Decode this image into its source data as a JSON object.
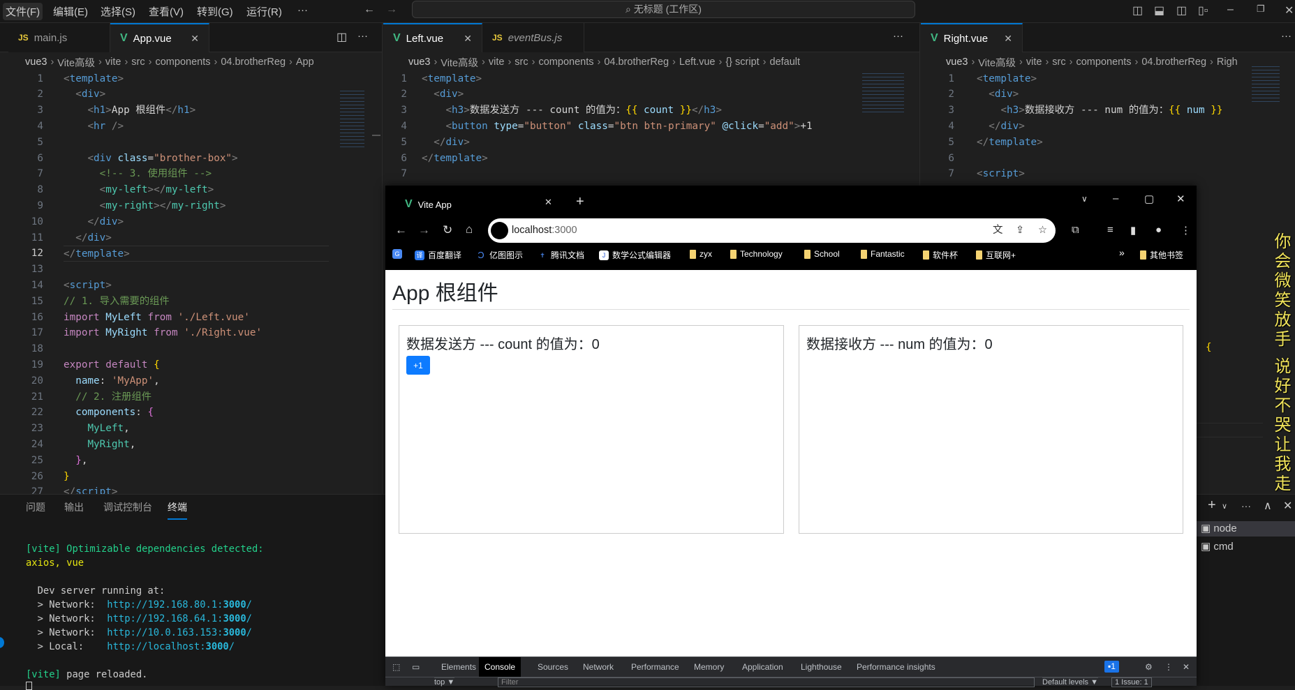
{
  "titlebar": {
    "menu": [
      "文件(F)",
      "编辑(E)",
      "选择(S)",
      "查看(V)",
      "转到(G)",
      "运行(R)",
      "···"
    ],
    "search": "无标题 (工作区)",
    "search_icon": "search-icon"
  },
  "editors": {
    "left": {
      "tabs": [
        {
          "label": "main.js",
          "icon": "JS"
        },
        {
          "label": "App.vue",
          "icon": "V",
          "close": "✕"
        }
      ],
      "breadcrumb": [
        "vue3",
        "Vite高级",
        "vite",
        "src",
        "components",
        "04.brotherReg",
        "App"
      ],
      "current_line": 12,
      "lines": [
        [
          [
            "p",
            "<"
          ],
          [
            "t",
            "template"
          ],
          [
            "p",
            ">"
          ]
        ],
        [
          [
            "w",
            "  "
          ],
          [
            "p",
            "<"
          ],
          [
            "t",
            "div"
          ],
          [
            "p",
            ">"
          ]
        ],
        [
          [
            "w",
            "    "
          ],
          [
            "p",
            "<"
          ],
          [
            "t",
            "h1"
          ],
          [
            "p",
            ">"
          ],
          [
            "w",
            "App 根组件"
          ],
          [
            "p",
            "</"
          ],
          [
            "t",
            "h1"
          ],
          [
            "p",
            ">"
          ]
        ],
        [
          [
            "w",
            "    "
          ],
          [
            "p",
            "<"
          ],
          [
            "t",
            "hr"
          ],
          [
            "p",
            " />"
          ]
        ],
        [],
        [
          [
            "w",
            "    "
          ],
          [
            "p",
            "<"
          ],
          [
            "t",
            "div"
          ],
          [
            "w",
            " "
          ],
          [
            "a",
            "class"
          ],
          [
            "w",
            "="
          ],
          [
            "s",
            "\"brother-box\""
          ],
          [
            "p",
            ">"
          ]
        ],
        [
          [
            "w",
            "      "
          ],
          [
            "c",
            "<!-- 3. 使用组件 -->"
          ]
        ],
        [
          [
            "w",
            "      "
          ],
          [
            "p",
            "<"
          ],
          [
            "g",
            "my-left"
          ],
          [
            "p",
            "></"
          ],
          [
            "g",
            "my-left"
          ],
          [
            "p",
            ">"
          ]
        ],
        [
          [
            "w",
            "      "
          ],
          [
            "p",
            "<"
          ],
          [
            "g",
            "my-right"
          ],
          [
            "p",
            "></"
          ],
          [
            "g",
            "my-right"
          ],
          [
            "p",
            ">"
          ]
        ],
        [
          [
            "w",
            "    "
          ],
          [
            "p",
            "</"
          ],
          [
            "t",
            "div"
          ],
          [
            "p",
            ">"
          ]
        ],
        [
          [
            "w",
            "  "
          ],
          [
            "p",
            "</"
          ],
          [
            "t",
            "div"
          ],
          [
            "p",
            ">"
          ]
        ],
        [
          [
            "p",
            "</"
          ],
          [
            "t",
            "template"
          ],
          [
            "p",
            ">"
          ]
        ],
        [],
        [
          [
            "p",
            "<"
          ],
          [
            "t",
            "script"
          ],
          [
            "p",
            ">"
          ]
        ],
        [
          [
            "c",
            "// 1. 导入需要的组件"
          ]
        ],
        [
          [
            "k",
            "import"
          ],
          [
            "w",
            " "
          ],
          [
            "v",
            "MyLeft"
          ],
          [
            "w",
            " "
          ],
          [
            "k",
            "from"
          ],
          [
            "w",
            " "
          ],
          [
            "s",
            "'./Left.vue'"
          ]
        ],
        [
          [
            "k",
            "import"
          ],
          [
            "w",
            " "
          ],
          [
            "v",
            "MyRight"
          ],
          [
            "w",
            " "
          ],
          [
            "k",
            "from"
          ],
          [
            "w",
            " "
          ],
          [
            "s",
            "'./Right.vue'"
          ]
        ],
        [],
        [
          [
            "k",
            "export"
          ],
          [
            "w",
            " "
          ],
          [
            "k",
            "default"
          ],
          [
            "w",
            " "
          ],
          [
            "y",
            "{"
          ]
        ],
        [
          [
            "w",
            "  "
          ],
          [
            "v",
            "name"
          ],
          [
            "w",
            ": "
          ],
          [
            "s",
            "'MyApp'"
          ],
          [
            "w",
            ","
          ]
        ],
        [
          [
            "w",
            "  "
          ],
          [
            "c",
            "// 2. 注册组件"
          ]
        ],
        [
          [
            "w",
            "  "
          ],
          [
            "v",
            "components"
          ],
          [
            "w",
            ": "
          ],
          [
            "m",
            "{"
          ]
        ],
        [
          [
            "w",
            "    "
          ],
          [
            "g",
            "MyLeft"
          ],
          [
            "w",
            ","
          ]
        ],
        [
          [
            "w",
            "    "
          ],
          [
            "g",
            "MyRight"
          ],
          [
            "w",
            ","
          ]
        ],
        [
          [
            "w",
            "  "
          ],
          [
            "m",
            "}"
          ],
          [
            "w",
            ","
          ]
        ],
        [
          [
            "y",
            "}"
          ]
        ],
        [
          [
            "p",
            "</"
          ],
          [
            "t",
            "script"
          ],
          [
            "p",
            ">"
          ]
        ]
      ]
    },
    "middle": {
      "tabs": [
        {
          "label": "Left.vue",
          "icon": "V",
          "close": "✕"
        },
        {
          "label": "eventBus.js",
          "icon": "JS"
        }
      ],
      "breadcrumb": [
        "vue3",
        "Vite高级",
        "vite",
        "src",
        "components",
        "04.brotherReg",
        "Left.vue",
        "{} script",
        "default"
      ],
      "lines": [
        [
          [
            "p",
            "<"
          ],
          [
            "t",
            "template"
          ],
          [
            "p",
            ">"
          ]
        ],
        [
          [
            "w",
            "  "
          ],
          [
            "p",
            "<"
          ],
          [
            "t",
            "div"
          ],
          [
            "p",
            ">"
          ]
        ],
        [
          [
            "w",
            "    "
          ],
          [
            "p",
            "<"
          ],
          [
            "t",
            "h3"
          ],
          [
            "p",
            ">"
          ],
          [
            "w",
            "数据发送方 --- count 的值为："
          ],
          [
            "y",
            "{{"
          ],
          [
            "v",
            " count "
          ],
          [
            "y",
            "}}"
          ],
          [
            "p",
            "</"
          ],
          [
            "t",
            "h3"
          ],
          [
            "p",
            ">"
          ]
        ],
        [
          [
            "w",
            "    "
          ],
          [
            "p",
            "<"
          ],
          [
            "t",
            "button"
          ],
          [
            "w",
            " "
          ],
          [
            "a",
            "type"
          ],
          [
            "w",
            "="
          ],
          [
            "s",
            "\"button\""
          ],
          [
            "w",
            " "
          ],
          [
            "a",
            "class"
          ],
          [
            "w",
            "="
          ],
          [
            "s",
            "\"btn btn-primary\""
          ],
          [
            "w",
            " "
          ],
          [
            "a",
            "@click"
          ],
          [
            "w",
            "="
          ],
          [
            "s",
            "\"add\""
          ],
          [
            "p",
            ">"
          ],
          [
            "w",
            "+1"
          ]
        ],
        [
          [
            "w",
            "  "
          ],
          [
            "p",
            "</"
          ],
          [
            "t",
            "div"
          ],
          [
            "p",
            ">"
          ]
        ],
        [
          [
            "p",
            "</"
          ],
          [
            "t",
            "template"
          ],
          [
            "p",
            ">"
          ]
        ],
        []
      ]
    },
    "right": {
      "tabs": [
        {
          "label": "Right.vue",
          "icon": "V",
          "close": "✕"
        }
      ],
      "breadcrumb": [
        "vue3",
        "Vite高级",
        "vite",
        "src",
        "components",
        "04.brotherReg",
        "Righ"
      ],
      "partial_brace": "{",
      "lines": [
        [
          [
            "p",
            "<"
          ],
          [
            "t",
            "template"
          ],
          [
            "p",
            ">"
          ]
        ],
        [
          [
            "w",
            "  "
          ],
          [
            "p",
            "<"
          ],
          [
            "t",
            "div"
          ],
          [
            "p",
            ">"
          ]
        ],
        [
          [
            "w",
            "    "
          ],
          [
            "p",
            "<"
          ],
          [
            "t",
            "h3"
          ],
          [
            "p",
            ">"
          ],
          [
            "w",
            "数据接收方 --- num 的值为："
          ],
          [
            "y",
            "{{"
          ],
          [
            "v",
            " num "
          ],
          [
            "y",
            "}}"
          ]
        ],
        [
          [
            "w",
            "  "
          ],
          [
            "p",
            "</"
          ],
          [
            "t",
            "div"
          ],
          [
            "p",
            ">"
          ]
        ],
        [
          [
            "p",
            "</"
          ],
          [
            "t",
            "template"
          ],
          [
            "p",
            ">"
          ]
        ],
        [],
        [
          [
            "p",
            "<"
          ],
          [
            "t",
            "script"
          ],
          [
            "p",
            ">"
          ]
        ]
      ]
    }
  },
  "panel": {
    "tabs": [
      "问题",
      "输出",
      "调试控制台",
      "终端"
    ],
    "active_tab": "终端",
    "terminal": [
      [
        [
          "tg",
          "[vite] Optimizable dependencies detected:"
        ]
      ],
      [
        [
          "ty",
          "axios, vue"
        ]
      ],
      [],
      [
        [
          "w",
          "  Dev server running at:"
        ]
      ],
      [
        [
          "w",
          "  > Network:  "
        ],
        [
          "tc",
          "http://192.168.80.1:"
        ],
        [
          "tcb",
          "3000"
        ],
        [
          "tc",
          "/"
        ]
      ],
      [
        [
          "w",
          "  > Network:  "
        ],
        [
          "tc",
          "http://192.168.64.1:"
        ],
        [
          "tcb",
          "3000"
        ],
        [
          "tc",
          "/"
        ]
      ],
      [
        [
          "w",
          "  > Network:  "
        ],
        [
          "tc",
          "http://10.0.163.153:"
        ],
        [
          "tcb",
          "3000"
        ],
        [
          "tc",
          "/"
        ]
      ],
      [
        [
          "w",
          "  > Local:    "
        ],
        [
          "tc",
          "http://localhost:"
        ],
        [
          "tcb",
          "3000"
        ],
        [
          "tc",
          "/"
        ]
      ],
      [],
      [
        [
          "tg",
          "[vite]"
        ],
        [
          "w",
          " page reloaded."
        ]
      ]
    ],
    "terminal_actions": [
      "+",
      "∨",
      "···",
      "∧",
      "✕"
    ],
    "terminals": [
      "node",
      "cmd"
    ]
  },
  "browser": {
    "tab_title": "Vite App",
    "address": {
      "host": "localhost",
      "port": ":3000"
    },
    "bookmarks": [
      {
        "label": "百度翻译",
        "icon": "译"
      },
      {
        "label": "亿图图示",
        "icon": "Ͻ"
      },
      {
        "label": "腾讯文档",
        "icon": "✝"
      },
      {
        "label": "数学公式编辑器",
        "icon": "J"
      },
      {
        "label": "zyx",
        "icon": "folder"
      },
      {
        "label": "Technology",
        "icon": "folder"
      },
      {
        "label": "School",
        "icon": "folder"
      },
      {
        "label": "Fantastic",
        "icon": "folder"
      },
      {
        "label": "软件杯",
        "icon": "folder"
      },
      {
        "label": "互联网+",
        "icon": "folder"
      }
    ],
    "more_bookmarks": "»",
    "other_bookmarks": "其他书签",
    "page": {
      "title": "App 根组件",
      "left_heading": "数据发送方 --- count 的值为：0",
      "add_button": "+1",
      "right_heading": "数据接收方 --- num 的值为：0"
    },
    "devtools": {
      "tabs": [
        "Elements",
        "Console",
        "Sources",
        "Network",
        "Performance",
        "Memory",
        "Application",
        "Lighthouse",
        "Performance insights"
      ],
      "active_tab": "Console",
      "issues_badge": "1",
      "context": "top ▼",
      "filter_placeholder": "Filter",
      "levels": "Default levels ▼",
      "issues": "1 Issue: 1"
    }
  },
  "lyrics": "你会微笑放手 说好不哭让我走"
}
